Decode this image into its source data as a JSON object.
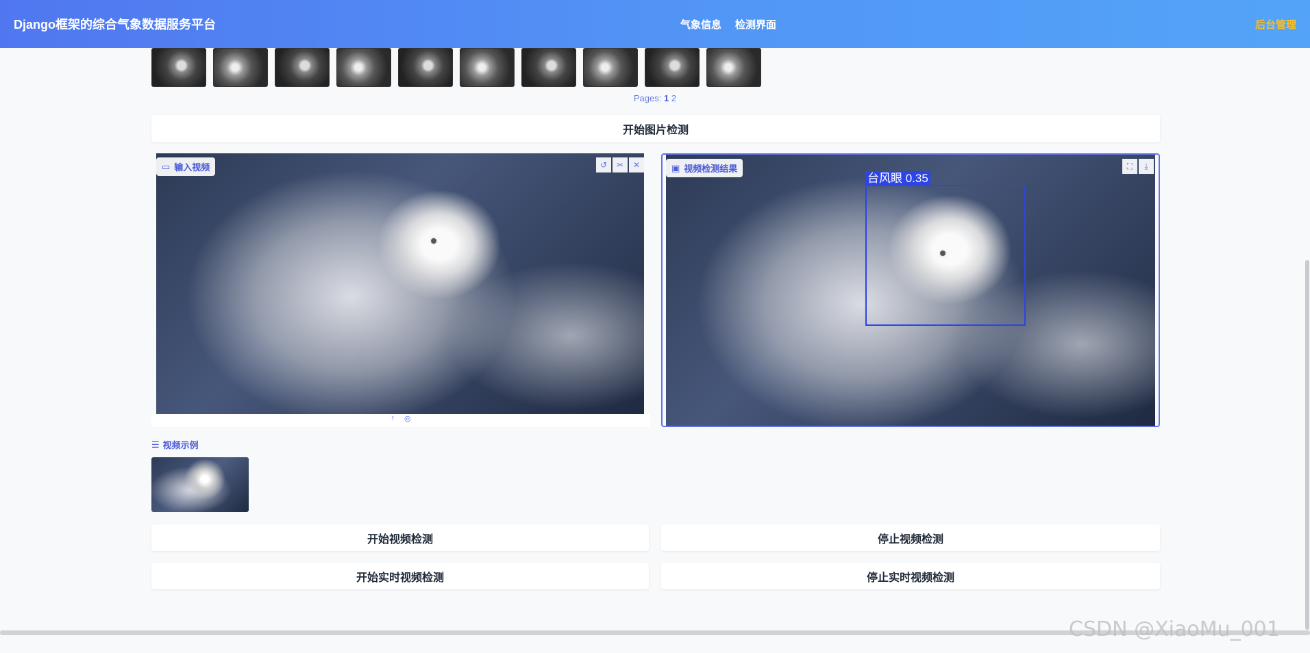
{
  "header": {
    "brand": "Django框架的综合气象数据服务平台",
    "nav": [
      "气象信息",
      "检测界面"
    ],
    "admin": "后台管理"
  },
  "gallery": {
    "pages_label": "Pages:",
    "page_current": "1",
    "page_other": "2"
  },
  "buttons": {
    "start_image": "开始图片检测",
    "start_video": "开始视频检测",
    "stop_video": "停止视频检测",
    "start_realtime": "开始实时视频检测",
    "stop_realtime": "停止实时视频检测"
  },
  "input_panel": {
    "label": "输入视频"
  },
  "result_panel": {
    "label": "视频检测结果",
    "detection_label": "台风眼 0.35"
  },
  "examples": {
    "label": "视频示例"
  },
  "watermark": "CSDN @XiaoMu_001",
  "colors": {
    "header_start": "#5077f0",
    "header_end": "#53a4f8",
    "accent": "#4b5ad8",
    "detection": "#2d44e6",
    "admin": "#fbbf24"
  }
}
